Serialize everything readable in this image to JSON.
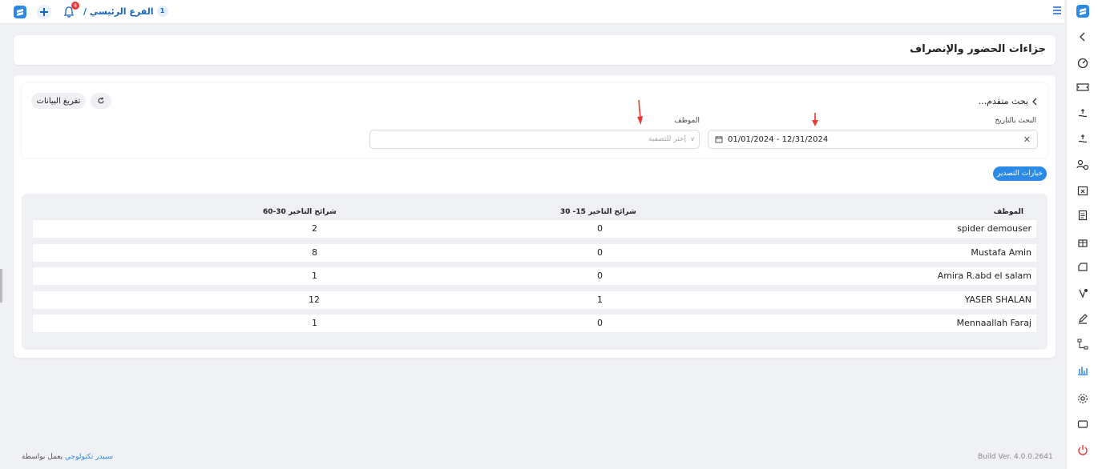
{
  "topbar": {
    "branch_number": "1",
    "branch_label": "الفرع الرئيسي /",
    "notification_count": "8"
  },
  "page": {
    "title": "جزاءات الحضور والإنصراف"
  },
  "search": {
    "advanced_label": "بحث متقدم...",
    "refresh_icon": "refresh-icon",
    "clear_label": "تفريغ البيانات",
    "date_label": "البحث بالتاريخ",
    "date_value": "01/01/2024 - 12/31/2024",
    "employee_label": "الموظف",
    "employee_placeholder": "إختر للتصفية"
  },
  "export_label": "خيارات التصدير",
  "table": {
    "headers": {
      "employee": "الموظف",
      "late_15_30": "شرائح التاخير 15- 30",
      "late_30_60": "شرائح التاخير 30-60"
    },
    "rows": [
      {
        "employee": "spider demouser",
        "late_15_30": "0",
        "late_30_60": "2"
      },
      {
        "employee": "Mustafa Amin",
        "late_15_30": "0",
        "late_30_60": "8"
      },
      {
        "employee": "Amira R.abd el salam",
        "late_15_30": "0",
        "late_30_60": "1"
      },
      {
        "employee": "YASER SHALAN",
        "late_15_30": "1",
        "late_30_60": "12"
      },
      {
        "employee": "Mennaallah Faraj",
        "late_15_30": "0",
        "late_30_60": "1"
      }
    ]
  },
  "footer": {
    "powered_by": "يعمل بواسطة",
    "company": "سبيدر تكنولوجي",
    "build": "Build Ver. 4.0.0.2641"
  },
  "colors": {
    "accent": "#2b8ae6",
    "brand": "#1565c0",
    "danger": "#e53935",
    "annotation_arrow": "#e53935"
  }
}
